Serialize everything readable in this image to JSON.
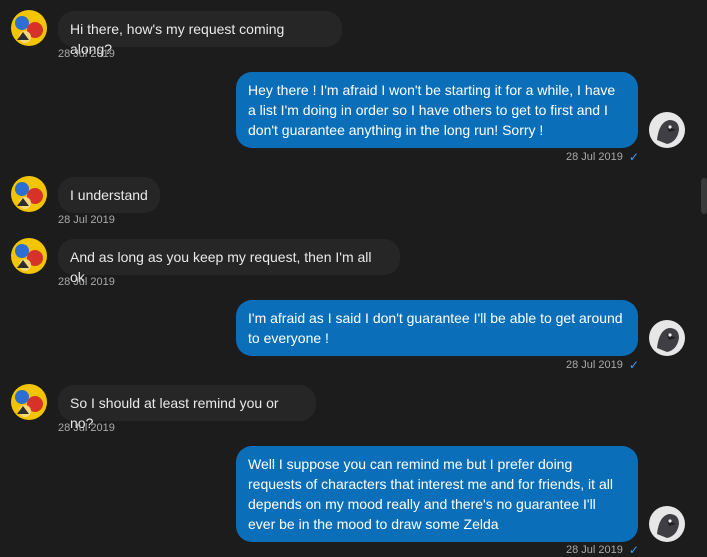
{
  "conversation": {
    "messages": [
      {
        "id": "m1",
        "direction": "incoming",
        "text": "Hi there, how's my request coming along?",
        "timestamp": "28 Jul 2019"
      },
      {
        "id": "m2",
        "direction": "outgoing",
        "text": "Hey there ! I'm afraid I won't be starting it for a while, I have a list I'm doing in order so I have others to get to first and I don't guarantee anything in the long run! Sorry !",
        "timestamp": "28 Jul 2019",
        "status": "✓"
      },
      {
        "id": "m3",
        "direction": "incoming",
        "text": "I understand",
        "timestamp": "28 Jul 2019"
      },
      {
        "id": "m4",
        "direction": "incoming",
        "text": "And as long as you keep my request, then I'm all ok",
        "timestamp": "28 Jul 2019"
      },
      {
        "id": "m5",
        "direction": "outgoing",
        "text": "I'm afraid as I said I don't guarantee I'll be able to get around to everyone !",
        "timestamp": "28 Jul 2019",
        "status": "✓"
      },
      {
        "id": "m6",
        "direction": "incoming",
        "text": "So I should at least remind you or no?",
        "timestamp": "28 Jul 2019"
      },
      {
        "id": "m7",
        "direction": "outgoing",
        "text": "Well I suppose you can remind me but I prefer doing requests of characters that interest me and for friends, it all depends on my mood really and there's no guarantee I'll ever be in the mood to draw some Zelda",
        "timestamp": "28 Jul 2019",
        "status": "✓"
      }
    ]
  },
  "colors": {
    "background": "#1c1c1d",
    "incoming_bubble": "#262627",
    "outgoing_bubble": "#0a6fb8",
    "timestamp": "#a9a9a9",
    "read_check": "#3aa0ff"
  },
  "icons": {
    "incoming_avatar": "user-avatar-icon",
    "outgoing_avatar": "user-avatar-icon",
    "status": "read-check-icon"
  }
}
